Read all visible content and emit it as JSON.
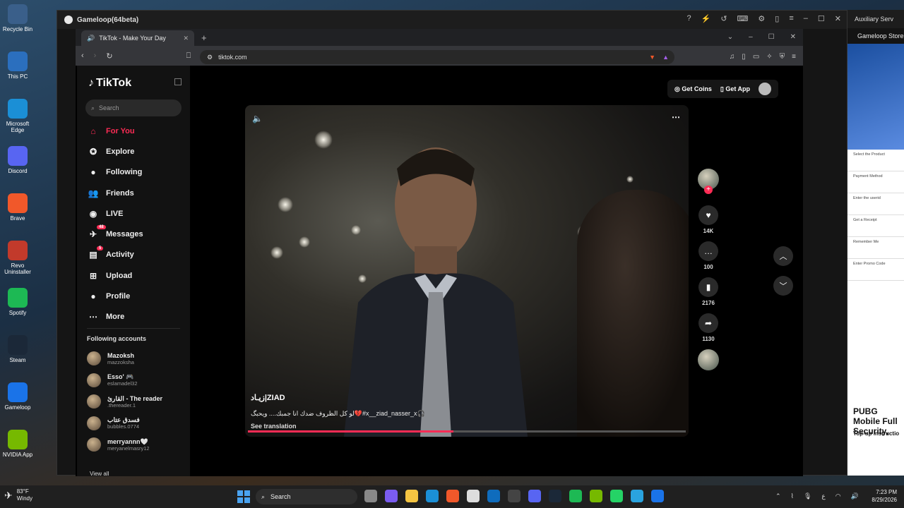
{
  "desktop_icons": [
    {
      "label": "Recycle Bin",
      "color": "#3a5f8a"
    },
    {
      "label": "This PC",
      "color": "#2b6fbe"
    },
    {
      "label": "Microsoft Edge",
      "color": "#1b8fd6"
    },
    {
      "label": "Discord",
      "color": "#5865f2"
    },
    {
      "label": "Brave",
      "color": "#f1582a"
    },
    {
      "label": "Revo Uninstaller",
      "color": "#c23a2b"
    },
    {
      "label": "Spotify",
      "color": "#1db954"
    },
    {
      "label": "Steam",
      "color": "#1b2838"
    },
    {
      "label": "Gameloop",
      "color": "#1a73e8"
    },
    {
      "label": "NVIDIA App",
      "color": "#76b900"
    }
  ],
  "gameloop": {
    "title": "Gameloop(64beta)"
  },
  "browser": {
    "tab_title": "TikTok - Make Your Day",
    "url": "tiktok.com"
  },
  "tiktok": {
    "brand": "TikTok",
    "search_placeholder": "Search",
    "nav": [
      {
        "label": "For You",
        "icon": "home-icon",
        "glyph": "⌂",
        "active": true
      },
      {
        "label": "Explore",
        "icon": "compass-icon",
        "glyph": "✪"
      },
      {
        "label": "Following",
        "icon": "following-avatar-icon",
        "glyph": "●"
      },
      {
        "label": "Friends",
        "icon": "friends-icon",
        "glyph": "👥"
      },
      {
        "label": "LIVE",
        "icon": "live-icon",
        "glyph": "◉"
      },
      {
        "label": "Messages",
        "icon": "messages-icon",
        "glyph": "✈",
        "badge": "48"
      },
      {
        "label": "Activity",
        "icon": "activity-icon",
        "glyph": "▤",
        "badge": "5"
      },
      {
        "label": "Upload",
        "icon": "upload-icon",
        "glyph": "⊞"
      },
      {
        "label": "Profile",
        "icon": "profile-icon",
        "glyph": "●"
      },
      {
        "label": "More",
        "icon": "more-icon",
        "glyph": "⋯"
      }
    ],
    "following_heading": "Following accounts",
    "following": [
      {
        "name": "Mazoksh",
        "handle": "mazzoksha"
      },
      {
        "name": "Esso' 🎮",
        "handle": "eslamadel32"
      },
      {
        "name": "القارئ - The reader",
        "handle": ".thereader.1"
      },
      {
        "name": "فسدق عتاب",
        "handle": "bubbles.0774"
      },
      {
        "name": "merryannn🤍",
        "handle": "meryanelmasry12"
      }
    ],
    "view_all": "View all",
    "top_actions": {
      "coins": "Get Coins",
      "app": "Get App"
    },
    "video": {
      "author": "زيـاد|ZIAD",
      "caption": "لو كل الظروف ضدك انا جمبك.... ويحبگ💔#x__ziad_nasser_x🎧",
      "see_translation": "See translation",
      "progress": 0.47
    },
    "actions": {
      "likes": "14K",
      "comments": "100",
      "saves": "2176",
      "shares": "1130"
    }
  },
  "right_panel": {
    "header": "Auxiliary Serv",
    "title": "Gameloop Store",
    "steps": [
      "Select the Product",
      "Payment Method",
      "Enter the userid",
      "Get a Receipt",
      "Remember Me",
      "Enter Promo Code"
    ],
    "headline": "PUBG Mobile Full Security,",
    "sub": "Top-up instructio"
  },
  "taskbar": {
    "temp": "83°F",
    "weather": "Windy",
    "search": "Search",
    "time": "7:23 PM",
    "date": "8/29/2026"
  }
}
